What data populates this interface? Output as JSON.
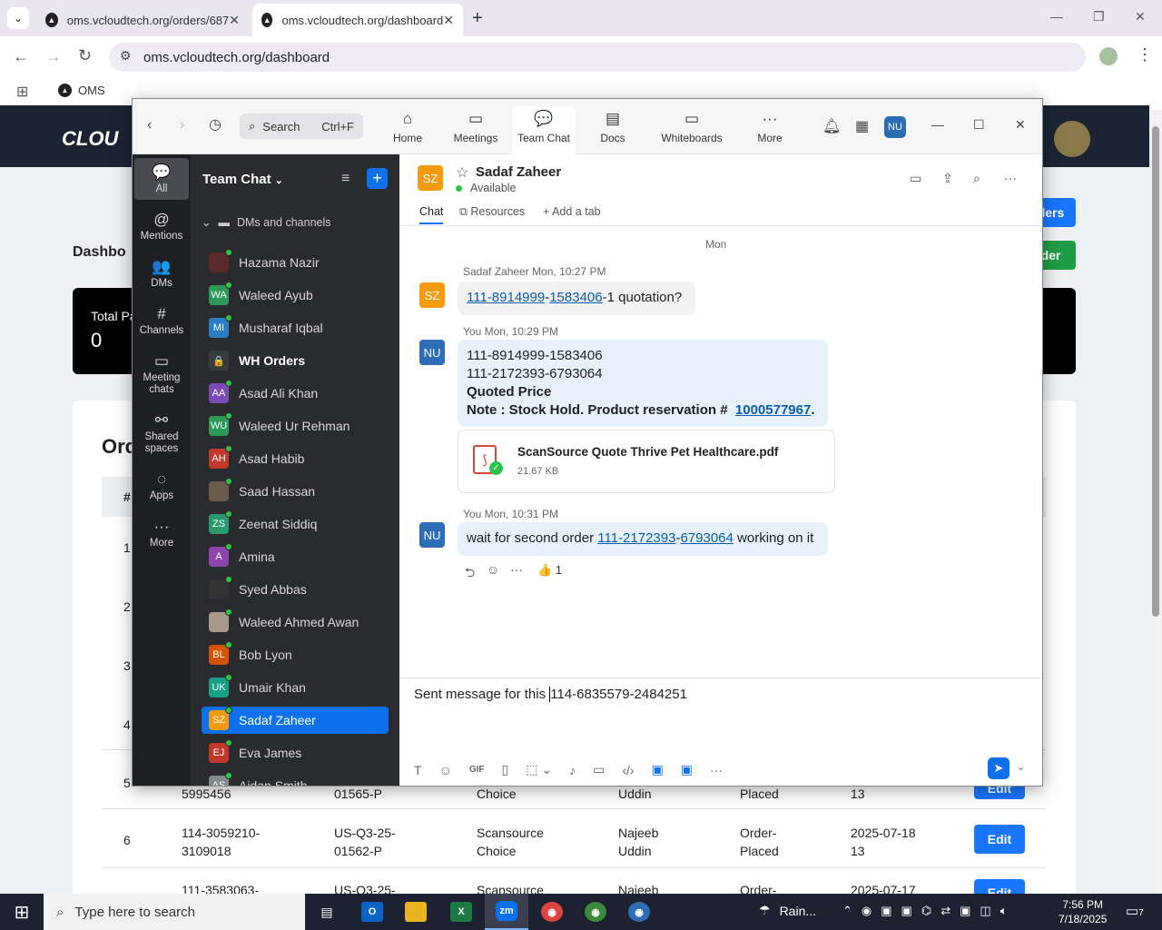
{
  "browser": {
    "tabs": [
      {
        "title": "oms.vcloudtech.org/orders/687"
      },
      {
        "title": "oms.vcloudtech.org/dashboard"
      }
    ],
    "url": "oms.vcloudtech.org/dashboard",
    "bookmark": "OMS",
    "win_min": "—",
    "win_max": "❐",
    "win_close": "✕"
  },
  "page": {
    "logo": "CLOU",
    "dash_title": "Dashbo",
    "total_label": "Total Pa",
    "total_value": "0",
    "orders_title": "Ord",
    "hash_col": "#",
    "btn_orders": "ders",
    "btn_order": "der",
    "row_nums": [
      "1",
      "2",
      "3",
      "4"
    ],
    "rows": [
      {
        "n": "5",
        "order": "5995456",
        "quote": "01565-P",
        "vendor": "Choice",
        "rep": "Uddin",
        "status": "Placed",
        "date": "13",
        "edit": "Edit"
      },
      {
        "n": "6",
        "order": "114-3059210-3109018",
        "quote": "US-Q3-25-01562-P",
        "vendor": "Scansource Choice",
        "rep": "Najeeb Uddin",
        "status": "Order-Placed",
        "date": "2025-07-18 13",
        "edit": "Edit"
      },
      {
        "n": "",
        "order": "111-3583063-",
        "quote": "US-Q3-25-",
        "vendor": "Scansource",
        "rep": "Najeeb",
        "status": "Order-",
        "date": "2025-07-17",
        "edit": "Edit"
      }
    ]
  },
  "zoom": {
    "search_label": "Search",
    "search_shortcut": "Ctrl+F",
    "nav": [
      {
        "label": "Home",
        "icon": "⌂"
      },
      {
        "label": "Meetings",
        "icon": "▭"
      },
      {
        "label": "Team Chat",
        "icon": "💬"
      },
      {
        "label": "Docs",
        "icon": "▤"
      },
      {
        "label": "Whiteboards",
        "icon": "▭"
      },
      {
        "label": "More",
        "icon": "···"
      }
    ],
    "avatar": "NU",
    "rail": [
      {
        "label": "All",
        "icon": "💬"
      },
      {
        "label": "Mentions",
        "icon": "@"
      },
      {
        "label": "DMs",
        "icon": "👥"
      },
      {
        "label": "Channels",
        "icon": "#"
      },
      {
        "label": "Meeting chats",
        "icon": "▭"
      },
      {
        "label": "Shared spaces",
        "icon": "⚯"
      },
      {
        "label": "Apps",
        "icon": "◌"
      },
      {
        "label": "More",
        "icon": "···"
      }
    ],
    "list_title": "Team Chat",
    "section": "DMs and channels",
    "contacts": [
      {
        "initials": "",
        "name": "Hazama Nazir",
        "color": "#5a2a2a"
      },
      {
        "initials": "WA",
        "name": "Waleed Ayub",
        "color": "#2e9a5a"
      },
      {
        "initials": "MI",
        "name": "Musharaf Iqbal",
        "color": "#2b7fc1"
      },
      {
        "initials": "🔒",
        "name": "WH Orders",
        "color": "#3a3b40"
      },
      {
        "initials": "AA",
        "name": "Asad Ali Khan",
        "color": "#7b4bb8"
      },
      {
        "initials": "WU",
        "name": "Waleed Ur Rehman",
        "color": "#2e9a5a"
      },
      {
        "initials": "AH",
        "name": "Asad Habib",
        "color": "#c0392b"
      },
      {
        "initials": "",
        "name": "Saad Hassan",
        "color": "#6b5b4b"
      },
      {
        "initials": "ZS",
        "name": "Zeenat Siddiq",
        "color": "#2a9a6e"
      },
      {
        "initials": "A",
        "name": "Amina",
        "color": "#8e44ad"
      },
      {
        "initials": "",
        "name": "Syed Abbas",
        "color": "#333"
      },
      {
        "initials": "",
        "name": "Waleed Ahmed Awan",
        "color": "#a89a8a"
      },
      {
        "initials": "BL",
        "name": "Bob Lyon",
        "color": "#d35400"
      },
      {
        "initials": "UK",
        "name": "Umair Khan",
        "color": "#16a085"
      },
      {
        "initials": "SZ",
        "name": "Sadaf Zaheer",
        "color": "#f39c12"
      },
      {
        "initials": "EJ",
        "name": "Eva James",
        "color": "#c0392b"
      },
      {
        "initials": "AS",
        "name": "Aidan Smith",
        "color": "#7f8c8d"
      }
    ],
    "chat": {
      "initials": "SZ",
      "name": "Sadaf Zaheer",
      "status": "Available",
      "tabs": [
        "Chat",
        "Resources",
        "Add a tab"
      ],
      "day": "Mon",
      "m1_sender": "Sadaf Zaheer",
      "m1_time": "Mon, 10:27 PM",
      "m1_a": "111-8914999",
      "m1_b": "-",
      "m1_c": "1583406",
      "m1_d": "-1 quotation?",
      "m2_sender": "You",
      "m2_time": "Mon, 10:29 PM",
      "m2_l1": "111-8914999-1583406",
      "m2_l2": "111-2172393-6793064",
      "m2_l3": "Quoted Price",
      "m2_l4": "Note : Stock Hold. Product reservation #",
      "m2_l4_link": "1000577967",
      "m2_l4_end": ".",
      "file_name": "ScanSource Quote Thrive Pet Healthcare.pdf",
      "file_size": "21.67 KB",
      "m3_sender": "You",
      "m3_time": "Mon, 10:31 PM",
      "m3_a": "wait for second order ",
      "m3_b": "111-2172393",
      "m3_c": "-",
      "m3_d": "6793064",
      "m3_e": " working on it",
      "reaction": "👍",
      "reaction_count": "1",
      "compose_before": "Sent message for this ",
      "compose_after": "114-6835579-2484251"
    }
  },
  "taskbar": {
    "search": "Type here to search",
    "weather": "Rain...",
    "time": "7:56 PM",
    "date": "7/18/2025",
    "notif": "7"
  }
}
